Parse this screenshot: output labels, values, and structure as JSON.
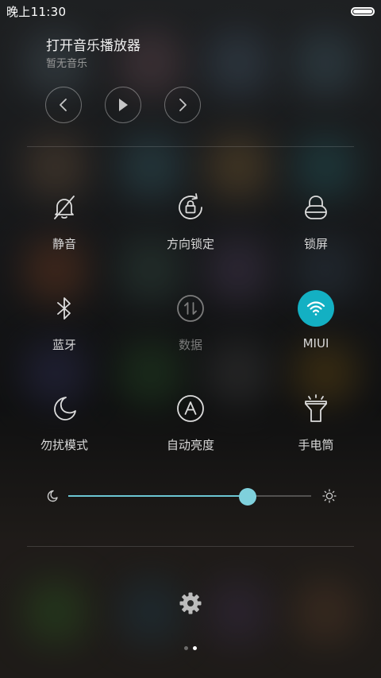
{
  "status_bar": {
    "time": "晚上11:30"
  },
  "music": {
    "title": "打开音乐播放器",
    "subtitle": "暂无音乐",
    "controls": [
      "chevron-left-icon",
      "play-icon",
      "chevron-right-icon"
    ]
  },
  "toggles": [
    {
      "id": "mute",
      "label": "静音",
      "icon": "bell-off-icon",
      "active": false,
      "enabled": true
    },
    {
      "id": "rotation-lock",
      "label": "方向锁定",
      "icon": "rotation-lock-icon",
      "active": false,
      "enabled": true
    },
    {
      "id": "lock-screen",
      "label": "锁屏",
      "icon": "lock-icon",
      "active": false,
      "enabled": true
    },
    {
      "id": "bluetooth",
      "label": "蓝牙",
      "icon": "bluetooth-icon",
      "active": false,
      "enabled": true
    },
    {
      "id": "data",
      "label": "数据",
      "icon": "data-arrows-icon",
      "active": false,
      "enabled": false
    },
    {
      "id": "wifi",
      "label": "MIUI",
      "icon": "wifi-icon",
      "active": true,
      "enabled": true
    },
    {
      "id": "dnd",
      "label": "勿扰模式",
      "icon": "moon-icon",
      "active": false,
      "enabled": true
    },
    {
      "id": "auto-brightness",
      "label": "自动亮度",
      "icon": "auto-brightness-icon",
      "active": false,
      "enabled": true
    },
    {
      "id": "flashlight",
      "label": "手电筒",
      "icon": "flashlight-icon",
      "active": false,
      "enabled": true
    }
  ],
  "brightness": {
    "level": 0.74
  },
  "colors": {
    "accent": "#13b0c3",
    "slider": "#7fd0dc"
  },
  "pagination": {
    "pages": 2,
    "current": 2
  }
}
